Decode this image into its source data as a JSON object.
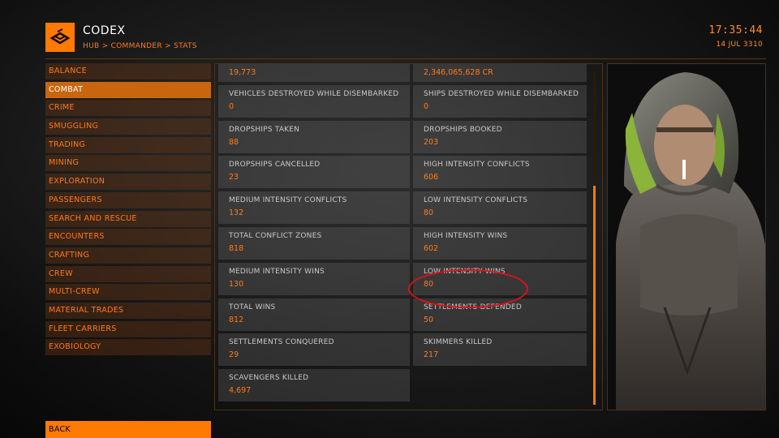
{
  "header": {
    "title": "CODEX",
    "breadcrumb": "HUB > COMMANDER > STATS",
    "time": "17:35:44",
    "date": "14 JUL 3310",
    "logo_icon": "codex-book-icon"
  },
  "sidebar": {
    "items": [
      {
        "label": "BALANCE"
      },
      {
        "label": "COMBAT",
        "active": true
      },
      {
        "label": "CRIME"
      },
      {
        "label": "SMUGGLING"
      },
      {
        "label": "TRADING"
      },
      {
        "label": "MINING"
      },
      {
        "label": "EXPLORATION"
      },
      {
        "label": "PASSENGERS"
      },
      {
        "label": "SEARCH AND RESCUE"
      },
      {
        "label": "ENCOUNTERS"
      },
      {
        "label": "CRAFTING"
      },
      {
        "label": "CREW"
      },
      {
        "label": "MULTI-CREW"
      },
      {
        "label": "MATERIAL TRADES"
      },
      {
        "label": "FLEET CARRIERS"
      },
      {
        "label": "EXOBIOLOGY"
      }
    ]
  },
  "stats": [
    {
      "label": "",
      "value": "19,773"
    },
    {
      "label": "",
      "value": "2,346,065,628 CR"
    },
    {
      "label": "VEHICLES DESTROYED WHILE DISEMBARKED",
      "value": "0"
    },
    {
      "label": "SHIPS DESTROYED WHILE DISEMBARKED",
      "value": "0"
    },
    {
      "label": "DROPSHIPS TAKEN",
      "value": "88"
    },
    {
      "label": "DROPSHIPS BOOKED",
      "value": "203"
    },
    {
      "label": "DROPSHIPS CANCELLED",
      "value": "23"
    },
    {
      "label": "HIGH INTENSITY CONFLICTS",
      "value": "606"
    },
    {
      "label": "MEDIUM INTENSITY CONFLICTS",
      "value": "132"
    },
    {
      "label": "LOW INTENSITY CONFLICTS",
      "value": "80"
    },
    {
      "label": "TOTAL CONFLICT ZONES",
      "value": "818"
    },
    {
      "label": "HIGH INTENSITY WINS",
      "value": "602"
    },
    {
      "label": "MEDIUM INTENSITY WINS",
      "value": "130"
    },
    {
      "label": "LOW INTENSITY WINS",
      "value": "80"
    },
    {
      "label": "TOTAL WINS",
      "value": "812"
    },
    {
      "label": "SETTLEMENTS DEFENDED",
      "value": "50"
    },
    {
      "label": "SETTLEMENTS CONQUERED",
      "value": "29"
    },
    {
      "label": "SKIMMERS KILLED",
      "value": "217"
    },
    {
      "label": "SCAVENGERS KILLED",
      "value": "4,697"
    }
  ],
  "back_label": "BACK",
  "colors": {
    "accent": "#ff7a00",
    "active_bg": "#c8660f",
    "highlight_circle": "#e0101a"
  }
}
